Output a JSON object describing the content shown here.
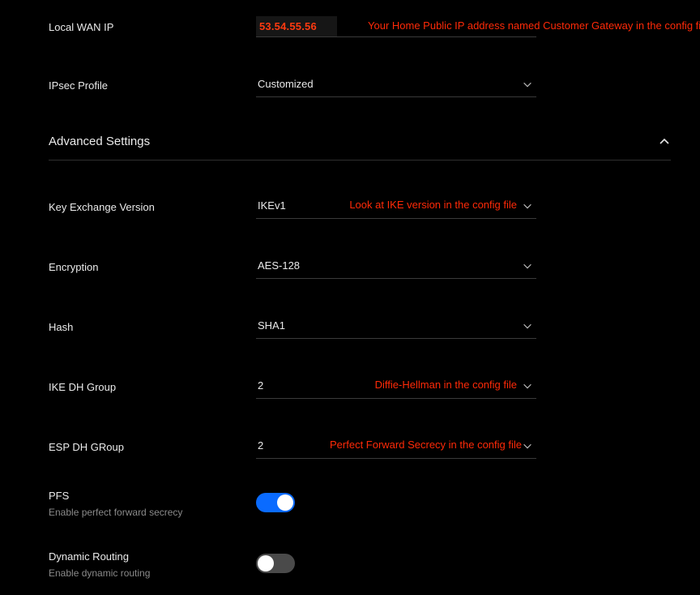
{
  "fields": {
    "local_wan_ip": {
      "label": "Local WAN IP",
      "value": "53.54.55.56",
      "note": "Your Home Public IP address named Customer Gateway in the config file"
    },
    "ipsec_profile": {
      "label": "IPsec Profile",
      "value": "Customized"
    }
  },
  "section": {
    "title": "Advanced Settings"
  },
  "adv": {
    "key_exchange": {
      "label": "Key Exchange Version",
      "value": "IKEv1",
      "note": "Look at IKE version in the config file"
    },
    "encryption": {
      "label": "Encryption",
      "value": "AES-128"
    },
    "hash": {
      "label": "Hash",
      "value": "SHA1"
    },
    "ike_dh": {
      "label": "IKE DH Group",
      "value": "2",
      "note": "Diffie-Hellman in the config file"
    },
    "esp_dh": {
      "label": "ESP DH GRoup",
      "value": "2",
      "note": "Perfect Forward Secrecy in the config file"
    },
    "pfs": {
      "label": "PFS",
      "sub": "Enable perfect forward secrecy",
      "on": true
    },
    "dynamic_routing": {
      "label": "Dynamic Routing",
      "sub": "Enable dynamic routing",
      "on": false
    }
  }
}
